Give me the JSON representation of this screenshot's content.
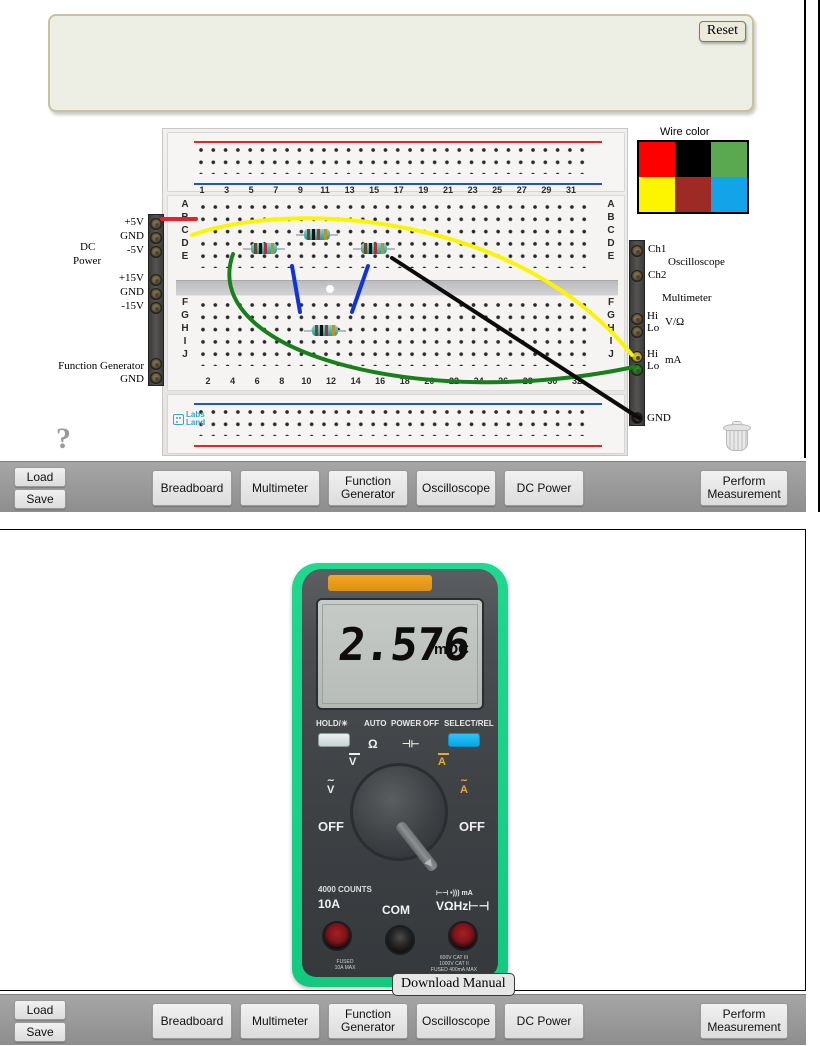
{
  "app": {
    "panels": [
      "breadboard",
      "multimeter"
    ]
  },
  "breadboard_panel": {
    "reset_label": "Reset",
    "message": "",
    "wire_color": {
      "title": "Wire color",
      "swatches": [
        {
          "name": "red",
          "hex": "#fe0000"
        },
        {
          "name": "black",
          "hex": "#000000"
        },
        {
          "name": "green",
          "hex": "#5aa košem"
        },
        {
          "name": "yellow",
          "hex": "#fdf500"
        },
        {
          "name": "dark-red",
          "hex": "#9e2a26"
        },
        {
          "name": "light-blue",
          "hex": "#13a3e8"
        }
      ]
    },
    "left_jacks": {
      "dc_power_title_line1": "DC",
      "dc_power_title_line2": "Power",
      "labels": [
        "+5V",
        "GND",
        "-5V",
        "+15V",
        "GND",
        "-15V"
      ],
      "function_generator_label": "Function Generator",
      "function_generator_gnd": "GND"
    },
    "right_jacks": {
      "oscilloscope_title": "Oscilloscope",
      "ch1": "Ch1",
      "ch2": "Ch2",
      "multimeter_title": "Multimeter",
      "vohm_hi": "Hi",
      "vohm_lo": "Lo",
      "vohm_label": "V/Ω",
      "ma_hi": "Hi",
      "ma_lo": "Lo",
      "ma_label": "mA",
      "gnd": "GND"
    },
    "board": {
      "brand": "Labs Land",
      "brand_line1": "Labs",
      "brand_line2": "Land",
      "top_columns": [
        "1",
        "3",
        "5",
        "7",
        "9",
        "11",
        "13",
        "15",
        "17",
        "19",
        "21",
        "23",
        "25",
        "27",
        "29",
        "31"
      ],
      "bottom_columns": [
        "2",
        "4",
        "6",
        "8",
        "10",
        "12",
        "14",
        "16",
        "18",
        "20",
        "22",
        "24",
        "26",
        "28",
        "30",
        "32"
      ],
      "rows_upper": [
        "A",
        "B",
        "C",
        "D",
        "E"
      ],
      "rows_lower": [
        "F",
        "G",
        "H",
        "I",
        "J"
      ]
    },
    "help_icon": "?",
    "trash_icon": "trash"
  },
  "multimeter_panel": {
    "display": {
      "reading": "2.576",
      "unit": "mDC"
    },
    "top_labels": {
      "hold": "HOLD/☀",
      "auto": "AUTO",
      "power": "POWER",
      "off": "OFF",
      "select": "SELECT/REL"
    },
    "dial_marks": {
      "ohm": "Ω",
      "diode": "⊢⊣",
      "v_dc": "V",
      "v_ac": "V",
      "a_dc": "A",
      "a_ac": "A",
      "off_left": "OFF",
      "off_right": "OFF"
    },
    "counts": "4000 COUNTS",
    "ports": [
      {
        "name": "10A",
        "label": "10A",
        "sub": "FUSED\n10A MAX",
        "color": "red"
      },
      {
        "name": "COM",
        "label": "COM",
        "sub": "",
        "color": "black"
      },
      {
        "name": "VOHMHZ",
        "label": "VΩHz⊢⊣",
        "sub": "600V CAT III\n1000V CAT II\nFUSED 400mA MAX",
        "color": "red",
        "top": "⊢⊣ •))) mA"
      }
    ],
    "download_manual_label": "Download Manual"
  },
  "toolbar": {
    "load_label": "Load",
    "save_label": "Save",
    "buttons": [
      {
        "name": "breadboard",
        "label": "Breadboard"
      },
      {
        "name": "multimeter",
        "label": "Multimeter"
      },
      {
        "name": "function-generator",
        "label": "Function\nGenerator"
      },
      {
        "name": "oscilloscope",
        "label": "Oscilloscope"
      },
      {
        "name": "dc-power",
        "label": "DC Power"
      }
    ],
    "perform_measurement_label": "Perform\nMeasurement"
  }
}
